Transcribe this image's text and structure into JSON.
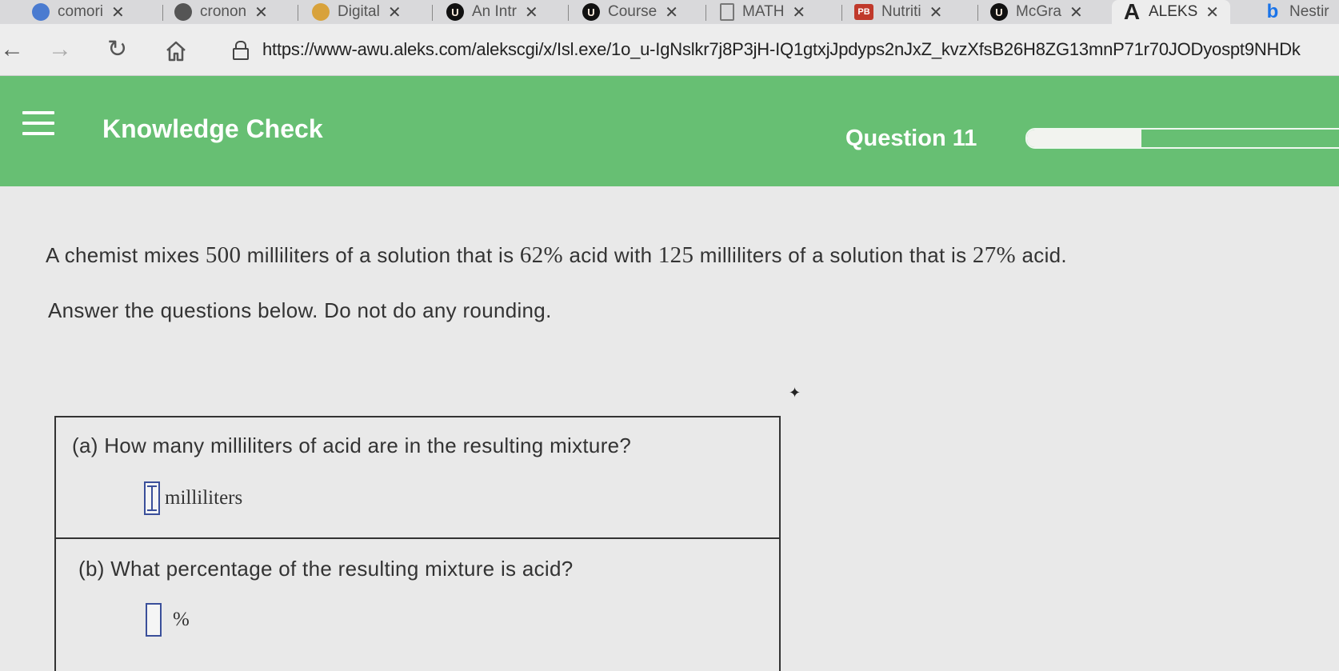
{
  "browser": {
    "tabs": [
      {
        "label": "comori",
        "icon": "site-icon"
      },
      {
        "label": "cronon",
        "icon": "site-icon"
      },
      {
        "label": "Digital",
        "icon": "site-icon"
      },
      {
        "label": "An Intr",
        "icon": "ux-icon"
      },
      {
        "label": "Course",
        "icon": "ux-icon"
      },
      {
        "label": "MATH",
        "icon": "doc-icon"
      },
      {
        "label": "Nutriti",
        "icon": "pb-icon"
      },
      {
        "label": "McGra",
        "icon": "ux-icon"
      },
      {
        "label": "ALEKS",
        "icon": "aleks-icon"
      },
      {
        "label": "Nestir",
        "icon": "bing-icon"
      }
    ],
    "tab_icon_text": {
      "pb": "PB",
      "aleks": "A",
      "bing": "b",
      "ux": "U"
    },
    "close_glyph": "✕",
    "url": "https://www-awu.aleks.com/alekscgi/x/Isl.exe/1o_u-IgNslkr7j8P3jH-IQ1gtxjJpdyps2nJxZ_kvzXfsB26H8ZG13mnP71r70JODyospt9NHDk",
    "nav_icons": [
      "back-arrow-icon",
      "forward-arrow-icon",
      "reload-icon",
      "home-icon",
      "lock-icon"
    ]
  },
  "header": {
    "title": "Knowledge Check",
    "question_label": "Question 11",
    "progress_fraction": 0.34,
    "bg_color": "#67bf73"
  },
  "problem": {
    "part1": "A chemist mixes ",
    "v1": "500",
    "part2": " milliliters of a solution that is ",
    "v2": "62%",
    "part3": " acid with ",
    "v3": "125",
    "part4": " milliliters of a solution that is ",
    "v4": "27%",
    "part5": " acid.",
    "instruction": "Answer the questions below. Do not do any rounding."
  },
  "questions": [
    {
      "text": "(a) How many milliliters of acid are in the resulting mixture?",
      "unit": "milliliters",
      "value": ""
    },
    {
      "text": "(b) What percentage of the resulting mixture is acid?",
      "unit": "%",
      "value": ""
    }
  ]
}
